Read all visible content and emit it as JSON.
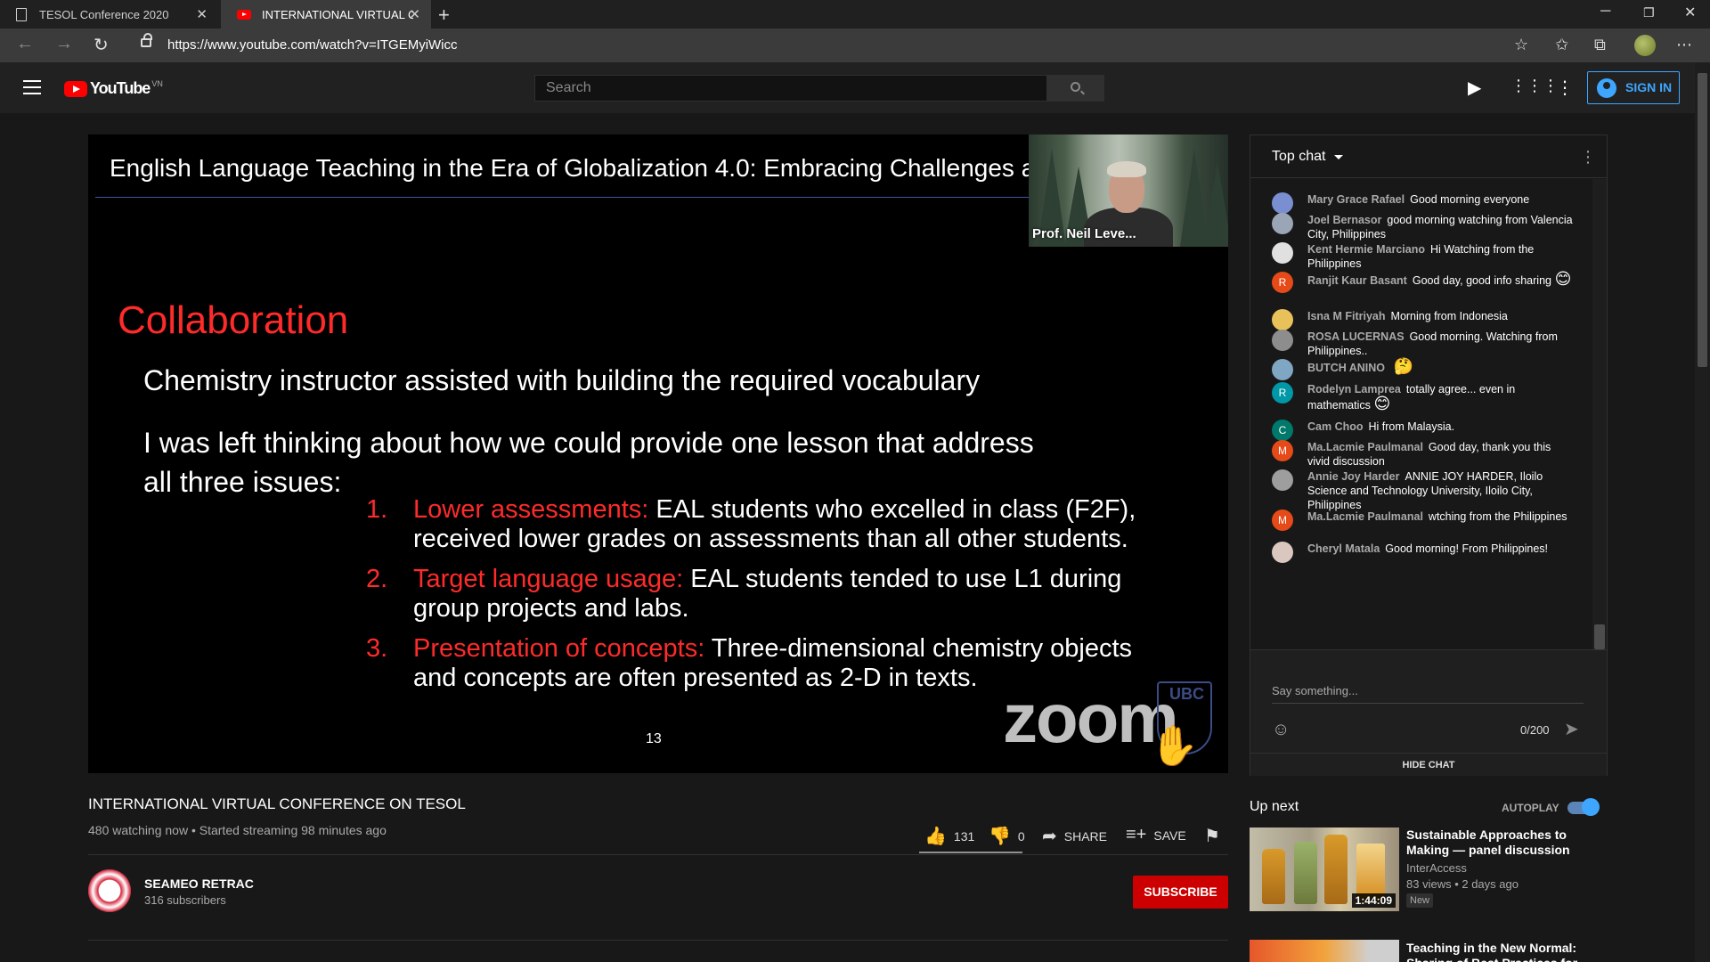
{
  "browser": {
    "tabs": [
      {
        "title": "TESOL Conference 2020",
        "icon": "document-icon"
      },
      {
        "title": "INTERNATIONAL VIRTUAL CONF",
        "icon": "youtube-icon"
      }
    ],
    "url": "https://www.youtube.com/watch?v=ITGEMyiWicc"
  },
  "youtube": {
    "logo_text": "YouTube",
    "country": "VN",
    "search_placeholder": "Search",
    "signin_label": "SIGN IN"
  },
  "slide": {
    "title": "English Language Teaching in the Era of Globalization 4.0: Embracing Challenges a",
    "speaker": "Prof. Neil Leve...",
    "heading": "Collaboration",
    "line1": "Chemistry instructor assisted with building the required vocabulary",
    "line2a": "I was left thinking about how we could provide one lesson that address",
    "line2b": "all three issues:",
    "items": [
      {
        "num": "1.",
        "lead": "Lower assessments:",
        "text": " EAL students who excelled in class (F2F), received lower grades on assessments than all other students."
      },
      {
        "num": "2.",
        "lead": "Target language usage:",
        "text": " EAL students tended to use L1 during group projects and labs."
      },
      {
        "num": "3.",
        "lead": "Presentation of concepts:",
        "text": " Three-dimensional chemistry objects and concepts are often presented as 2-D in texts."
      }
    ],
    "page_number": "13",
    "watermark": "zoom",
    "logo_text": "UBC"
  },
  "video": {
    "title": "INTERNATIONAL VIRTUAL CONFERENCE ON TESOL",
    "meta": "480 watching now • Started streaming 98 minutes ago",
    "likes": "131",
    "dislikes": "0",
    "share_label": "SHARE",
    "save_label": "SAVE"
  },
  "channel": {
    "name": "SEAMEO RETRAC",
    "subscribers": "316 subscribers",
    "subscribe_label": "SUBSCRIBE"
  },
  "chat": {
    "header": "Top chat",
    "messages": [
      {
        "author": "Mary Grace Rafael",
        "text": "Good morning everyone",
        "avatar": "",
        "color": "#7a8fd1"
      },
      {
        "author": "Joel Bernasor",
        "text": "good morning watching from Valencia City, Philippines",
        "avatar": "",
        "color": "#9aa6b5"
      },
      {
        "author": "Kent Hermie Marciano",
        "text": "Hi Watching from the Philippines",
        "avatar": "",
        "color": "#e0e0e0"
      },
      {
        "author": "Ranjit Kaur Basant",
        "text": "Good day, good info sharing",
        "emoji": "😊",
        "avatar": "R",
        "color": "#e64a19"
      },
      {
        "author": "Isna M Fitriyah",
        "text": "Morning from Indonesia",
        "avatar": "",
        "color": "#e8c15a"
      },
      {
        "author": "ROSA LUCERNAS",
        "text": "Good morning. Watching from Philippines..",
        "avatar": "",
        "color": "#8d8d8d"
      },
      {
        "author": "BUTCH ANINO",
        "text": "",
        "emoji": "🤔",
        "avatar": "",
        "color": "#7fa6c2"
      },
      {
        "author": "Rodelyn Lamprea",
        "text": "totally agree... even in mathematics",
        "emoji": "😊",
        "avatar": "R",
        "color": "#0097a7"
      },
      {
        "author": "Cam Choo",
        "text": "Hi from Malaysia.",
        "avatar": "C",
        "color": "#00796b"
      },
      {
        "author": "Ma.Lacmie Paulmanal",
        "text": "Good day, thank you this vivid discussion",
        "avatar": "M",
        "color": "#e64a19"
      },
      {
        "author": "Annie Joy Harder",
        "text": "ANNIE JOY HARDER, Iloilo Science and Technology University, Iloilo City, Philippines",
        "avatar": "",
        "color": "#9e9e9e"
      },
      {
        "author": "Ma.Lacmie Paulmanal",
        "text": "wtching from the Philippines",
        "avatar": "M",
        "color": "#e64a19"
      },
      {
        "author": "Cheryl Matala",
        "text": "Good morning! From Philippines!",
        "avatar": "",
        "color": "#d9c7c0"
      }
    ],
    "input_placeholder": "Say something...",
    "char_count": "0/200",
    "hide_label": "HIDE CHAT"
  },
  "upnext": {
    "label": "Up next",
    "autoplay_label": "AUTOPLAY",
    "autoplay_on": true,
    "items": [
      {
        "title": "Sustainable Approaches to Making — panel discussion",
        "channel": "InterAccess",
        "views": "83 views • 2 days ago",
        "badge": "New",
        "duration": "1:44:09"
      },
      {
        "title": "Teaching in the New Normal: Sharing of Best Practices for"
      }
    ]
  }
}
